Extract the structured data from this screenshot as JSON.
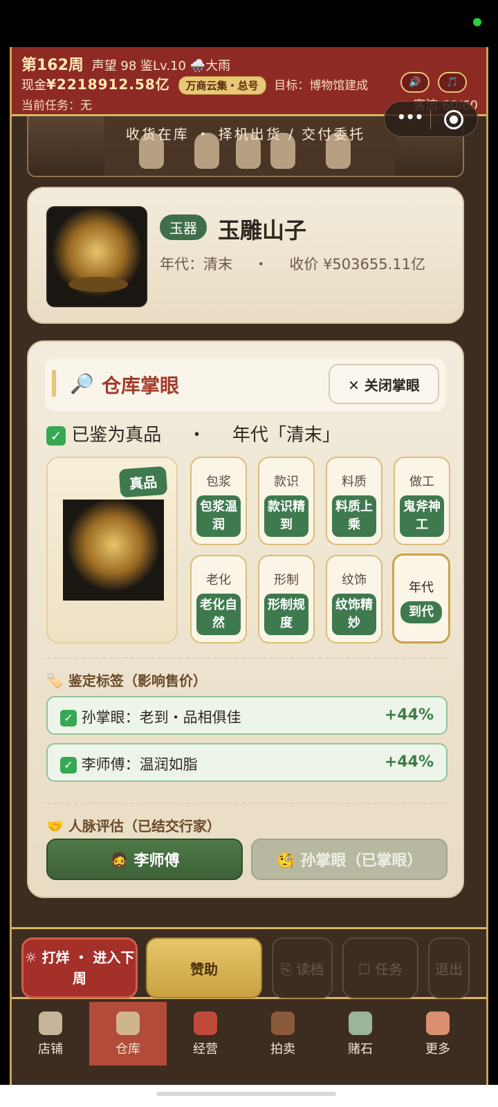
{
  "header": {
    "week": "第162周",
    "reputation": "声望 98",
    "appraise_level": "鉴Lv.10",
    "weather_icon": "🌧️",
    "weather": "大雨",
    "cash_label": "现金",
    "cash_value": "¥2218912.58亿",
    "badge": "万商云集・总号",
    "goal": "目标：博物馆建成",
    "task": "当前任务：无",
    "visitors": "客流 60/60",
    "sound_icon": "🔊",
    "music_icon": "🎵"
  },
  "banner": {
    "text": "收货在库 ・ 择机出货 / 交付委托"
  },
  "capsule": {
    "more": "•••"
  },
  "item": {
    "category": "玉器",
    "name": "玉雕山子",
    "era": "年代：清末",
    "dot": "・",
    "price": "收价 ¥503655.11亿"
  },
  "appraisal": {
    "icon": "🔎",
    "title": "仓库掌眼",
    "close_label": "✕ 关闭掌眼",
    "check": "✓",
    "verdict": "已鉴为真品",
    "verdict_dot": "・",
    "verdict_era": "年代「清末」",
    "seal": "真品",
    "traits": [
      {
        "name": "包浆",
        "value": "包浆温润"
      },
      {
        "name": "款识",
        "value": "款识精到"
      },
      {
        "name": "料质",
        "value": "料质上乘"
      },
      {
        "name": "做工",
        "value": "鬼斧神工"
      },
      {
        "name": "老化",
        "value": "老化自然"
      },
      {
        "name": "形制",
        "value": "形制规度"
      },
      {
        "name": "纹饰",
        "value": "纹饰精妙"
      },
      {
        "name": "年代",
        "value": "到代"
      }
    ],
    "labels_title": "🏷️ 鉴定标签（影响售价）",
    "labels": [
      {
        "text": "孙掌眼：老到・品相俱佳",
        "pct": "+44%"
      },
      {
        "text": "李师傅：温润如脂",
        "pct": "+44%"
      }
    ],
    "network_title": "🤝 人脉评估（已结交行家）",
    "contact_primary": "🧔 李师傅",
    "contact_disabled": "🧐 孙掌眼（已掌眼）"
  },
  "actions": {
    "advance": "☼ 打烊 ・ 进入下周",
    "sponsor": "赞助",
    "load": "⎘ 读档",
    "tasks": "☐ 任务",
    "exit": "退出"
  },
  "tabs": [
    {
      "label": "店铺",
      "icon_color": "#c7b59a"
    },
    {
      "label": "仓库",
      "icon_color": "#d2b48c"
    },
    {
      "label": "经营",
      "icon_color": "#c04a3a"
    },
    {
      "label": "拍卖",
      "icon_color": "#8a5a3a"
    },
    {
      "label": "赌石",
      "icon_color": "#9ab59a"
    },
    {
      "label": "更多",
      "icon_color": "#d99070"
    }
  ]
}
